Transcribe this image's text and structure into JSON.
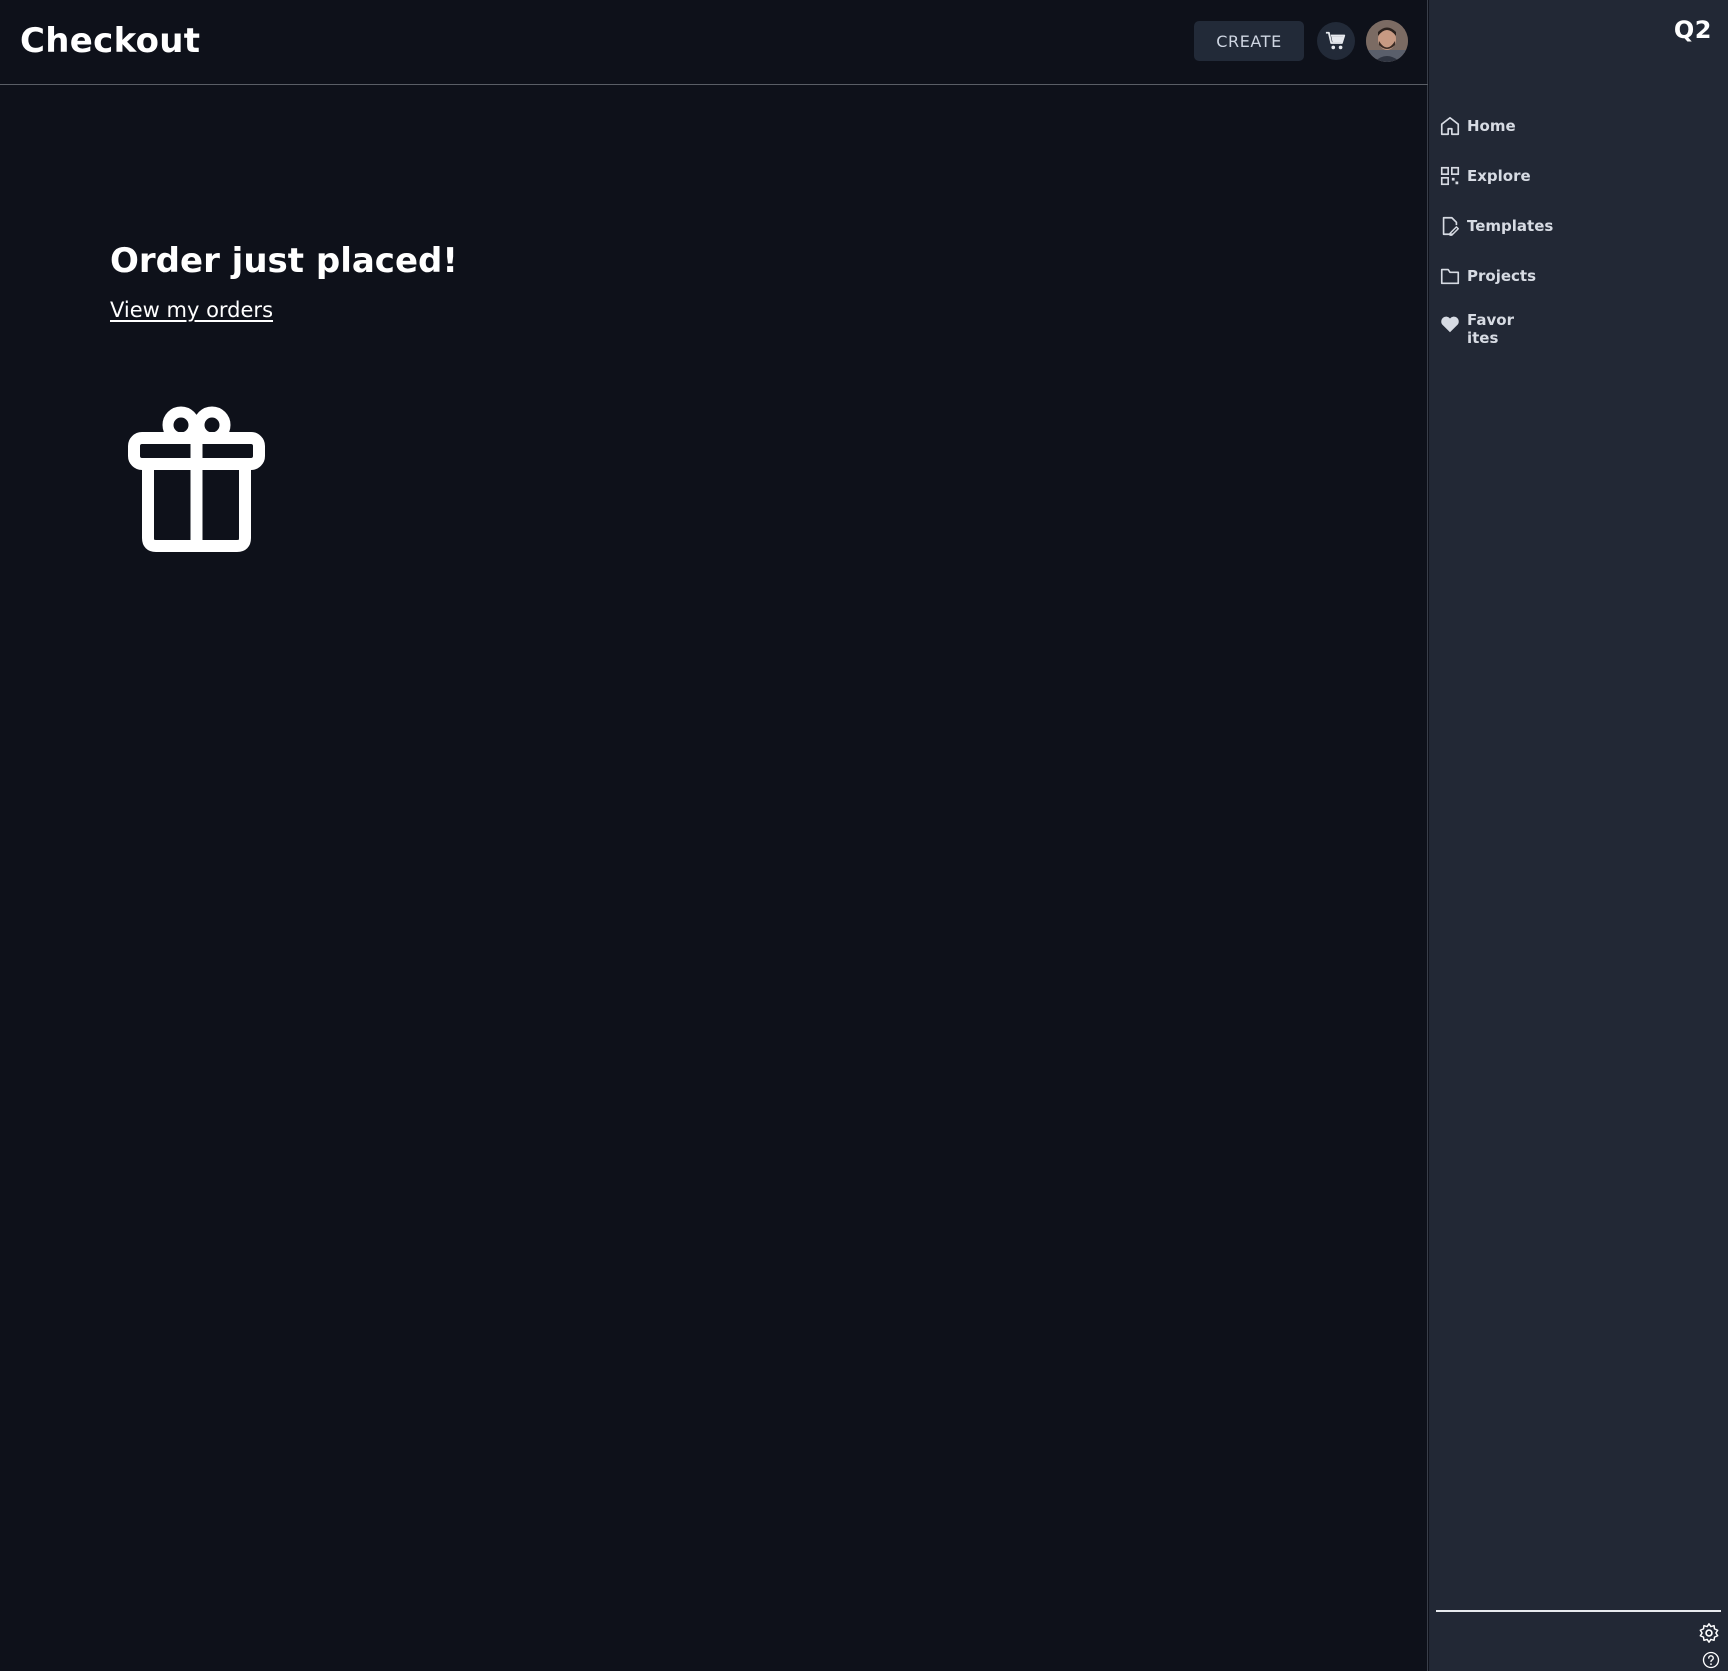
{
  "header": {
    "title": "Checkout",
    "create_label": "CREATE"
  },
  "main": {
    "heading": "Order just placed!",
    "orders_link": "View my orders"
  },
  "sidebar": {
    "brand": "Q2",
    "items": [
      {
        "label": "Home",
        "icon": "home-icon"
      },
      {
        "label": "Explore",
        "icon": "grid-icon"
      },
      {
        "label": "Templates",
        "icon": "document-edit-icon"
      },
      {
        "label": "Projects",
        "icon": "folder-icon"
      },
      {
        "label": "Favorites",
        "icon": "heart-icon"
      }
    ]
  },
  "colors": {
    "background": "#0e111a",
    "sidebar": "#222835",
    "button": "#222a38",
    "text": "#ffffff"
  }
}
